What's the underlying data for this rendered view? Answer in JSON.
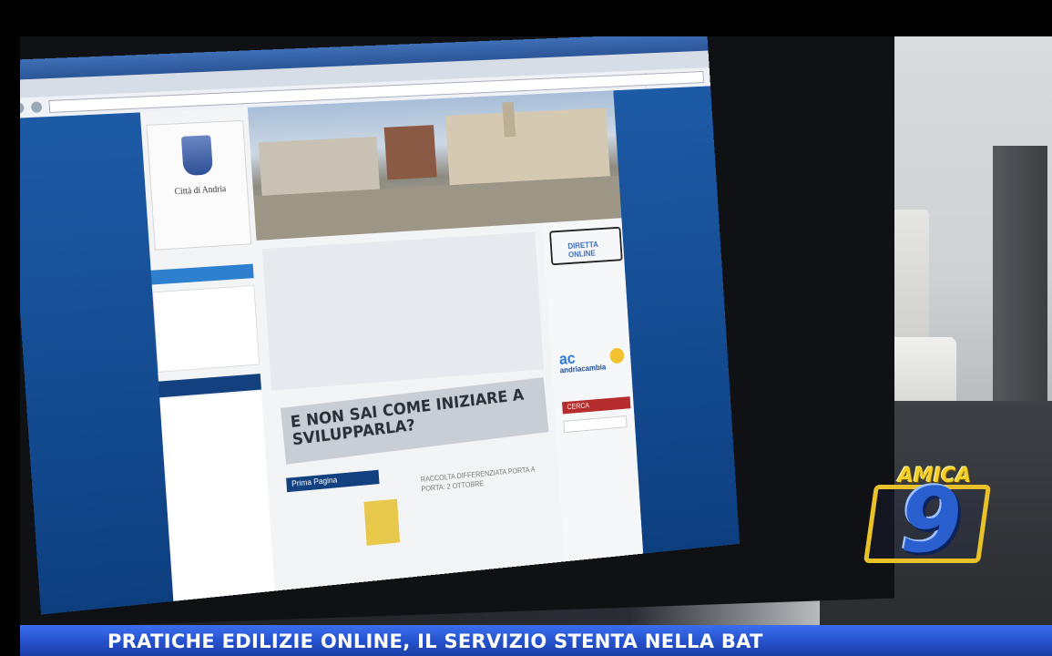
{
  "ticker": {
    "headline": "PRATICHE EDILIZIE ONLINE, IL SERVIZIO STENTA NELLA BAT"
  },
  "broadcaster": {
    "name": "AMICA",
    "channel_number": "9"
  },
  "website": {
    "city_name": "Città di Andria",
    "diretta_label": "DIRETTA ONLINE",
    "promo_text": "E NON SAI COME INIZIARE A SVILUPPARLA?",
    "andria_label": "andriacambia",
    "andria_mark": "ac",
    "cerca_label": "CERCA",
    "prima_pagina_label": "Prima Pagina",
    "prima_pagina_text": "RACCOLTA DIFFERENZIATA PORTA A PORTA: 2 OTTOBRE"
  },
  "colors": {
    "ticker": "#2450c9",
    "logo_gold": "#e9c22b",
    "logo_blue": "#2a5fd0"
  }
}
